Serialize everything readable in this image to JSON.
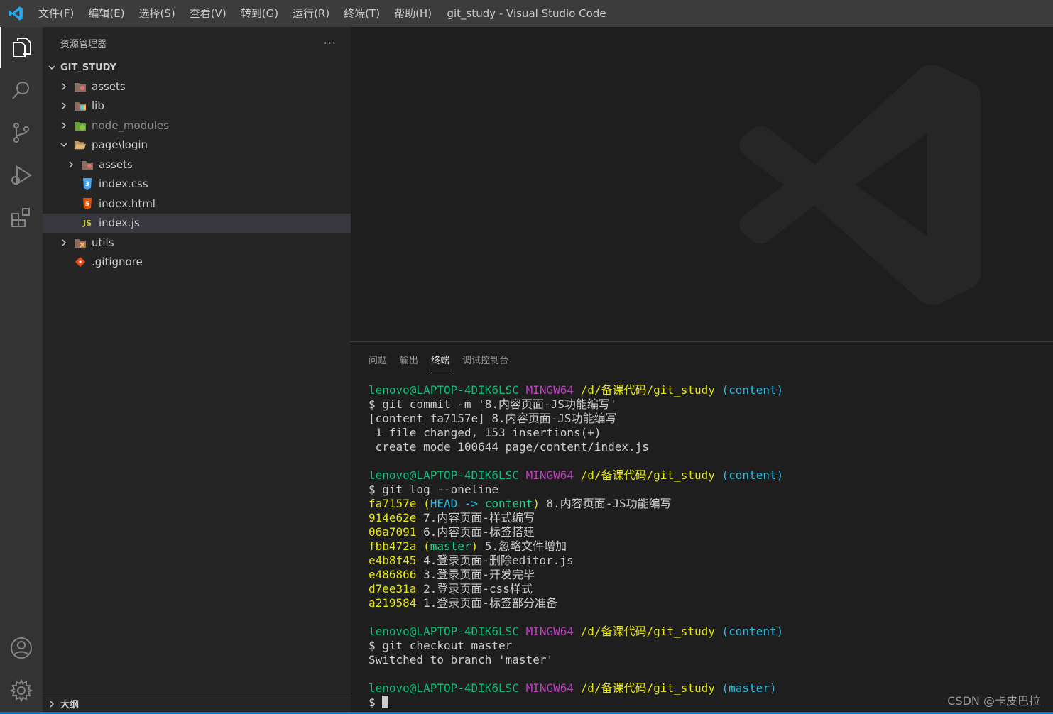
{
  "menu": [
    "文件(F)",
    "编辑(E)",
    "选择(S)",
    "查看(V)",
    "转到(G)",
    "运行(R)",
    "终端(T)",
    "帮助(H)"
  ],
  "window_title": "git_study - Visual Studio Code",
  "sidebar": {
    "title": "资源管理器",
    "more": "···",
    "project": "GIT_STUDY",
    "items": [
      {
        "label": "assets",
        "indent": 0,
        "type": "folder",
        "icon": "assets-folder-icon"
      },
      {
        "label": "lib",
        "indent": 0,
        "type": "folder",
        "icon": "lib-folder-icon"
      },
      {
        "label": "node_modules",
        "indent": 0,
        "type": "folder",
        "icon": "node-folder-icon"
      },
      {
        "label": "page\\login",
        "indent": 0,
        "type": "folder-open",
        "icon": "folder-open-icon"
      },
      {
        "label": "assets",
        "indent": 1,
        "type": "folder",
        "icon": "assets-folder-icon"
      },
      {
        "label": "index.css",
        "indent": 1,
        "type": "file",
        "icon": "css-file-icon"
      },
      {
        "label": "index.html",
        "indent": 1,
        "type": "file",
        "icon": "html-file-icon"
      },
      {
        "label": "index.js",
        "indent": 1,
        "type": "file",
        "icon": "js-file-icon"
      },
      {
        "label": "utils",
        "indent": 0,
        "type": "folder",
        "icon": "utils-folder-icon"
      },
      {
        "label": ".gitignore",
        "indent": 0,
        "type": "file",
        "icon": "git-file-icon"
      }
    ],
    "outline": "大纲"
  },
  "panel": {
    "tabs": [
      "问题",
      "输出",
      "终端",
      "调试控制台"
    ],
    "active_tab": "终端"
  },
  "terminal": {
    "prompt_user": "lenovo@LAPTOP-4DIK6LSC",
    "prompt_env": "MINGW64",
    "prompt_path": "/d/备课代码/git_study",
    "blocks": [
      {
        "branch": "(content)",
        "cmd": "$ git commit -m '8.内容页面-JS功能编写'",
        "output": [
          "[content fa7157e] 8.内容页面-JS功能编写",
          " 1 file changed, 153 insertions(+)",
          " create mode 100644 page/content/index.js"
        ]
      },
      {
        "branch": "(content)",
        "cmd": "$ git log --oneline",
        "log": [
          {
            "hash": "fa7157e",
            "ref_open": "(",
            "ref_head": "HEAD -> ",
            "ref_branch": "content",
            "ref_close": ")",
            "msg": " 8.内容页面-JS功能编写"
          },
          {
            "hash": "914e62e",
            "msg": " 7.内容页面-样式编写"
          },
          {
            "hash": "06a7091",
            "msg": " 6.内容页面-标签搭建"
          },
          {
            "hash": "fbb472a",
            "ref_open": "(",
            "ref_branch": "master",
            "ref_close": ")",
            "msg": " 5.忽略文件增加"
          },
          {
            "hash": "e4b8f45",
            "msg": " 4.登录页面-删除editor.js"
          },
          {
            "hash": "e486866",
            "msg": " 3.登录页面-开发完毕"
          },
          {
            "hash": "d7ee31a",
            "msg": " 2.登录页面-css样式"
          },
          {
            "hash": "a219584",
            "msg": " 1.登录页面-标签部分准备"
          }
        ]
      },
      {
        "branch": "(content)",
        "cmd": "$ git checkout master",
        "output": [
          "Switched to branch 'master'"
        ]
      },
      {
        "branch": "(master)",
        "cmd": "$ "
      }
    ]
  },
  "watermark": "CSDN @卡皮巴拉",
  "colors": {
    "accent": "#007acc",
    "titlebar": "#3c3c3c",
    "sidebar": "#252526",
    "activitybar": "#333333",
    "editor": "#1e1e1e"
  }
}
